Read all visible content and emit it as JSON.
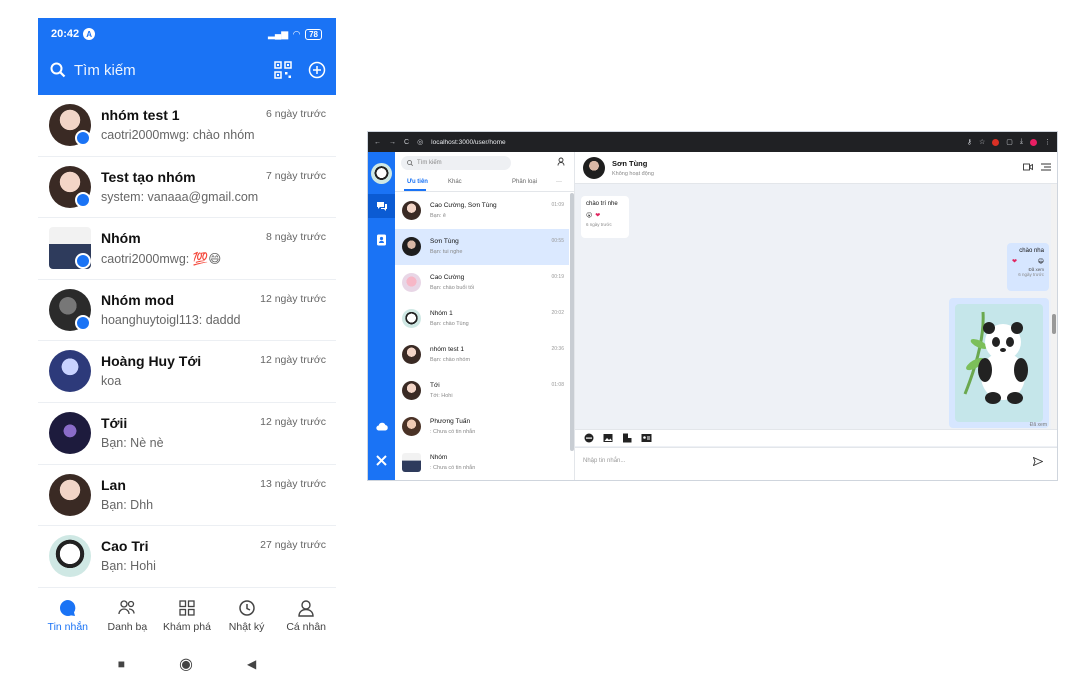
{
  "phone": {
    "status": {
      "time": "20:42",
      "badge": "A",
      "battery": "78"
    },
    "search_label": "Tìm kiếm",
    "conversations": [
      {
        "name": "nhóm test 1",
        "message": "caotri2000mwg: chào nhóm",
        "time": "6 ngày trước",
        "group": true
      },
      {
        "name": "Test tạo nhóm",
        "message": "system: vanaaa@gmail.com",
        "time": "7 ngày trước",
        "group": true
      },
      {
        "name": "Nhóm",
        "message": "caotri2000mwg: 💯😄",
        "time": "8 ngày trước",
        "group": true
      },
      {
        "name": "Nhóm mod",
        "message": "hoanghuytoigl113: daddd",
        "time": "12 ngày trước",
        "group": true
      },
      {
        "name": "Hoàng Huy Tới",
        "message": "koa",
        "time": "12 ngày trước",
        "group": false
      },
      {
        "name": "Tớii",
        "message": "Bạn: Nè nè",
        "time": "12 ngày trước",
        "group": false
      },
      {
        "name": "Lan",
        "message": "Bạn: Dhh",
        "time": "13 ngày trước",
        "group": false
      },
      {
        "name": "Cao Tri",
        "message": "Bạn: Hohi",
        "time": "27 ngày trước",
        "group": false
      }
    ],
    "nav": [
      {
        "label": "Tin nhắn",
        "icon": "chat-bubble-icon",
        "active": true
      },
      {
        "label": "Danh bạ",
        "icon": "contacts-icon",
        "active": false
      },
      {
        "label": "Khám phá",
        "icon": "grid-icon",
        "active": false
      },
      {
        "label": "Nhật ký",
        "icon": "clock-icon",
        "active": false
      },
      {
        "label": "Cá nhân",
        "icon": "person-icon",
        "active": false
      }
    ],
    "accent": "#1a73f5"
  },
  "browser": {
    "url": "localhost:3000/user/home",
    "search_placeholder": "Tìm kiếm",
    "tabs": {
      "priority": "Ưu tiên",
      "other": "Khác",
      "classify": "Phân loại",
      "more": "···"
    },
    "conversations": [
      {
        "name": "Cao Cường, Sơn Tùng",
        "message": "Bạn: ê",
        "time": "01:09",
        "selected": false
      },
      {
        "name": "Sơn Tùng",
        "message": "Bạn: tui nghe",
        "time": "00:55",
        "selected": true
      },
      {
        "name": "Cao Cường",
        "message": "Bạn: chào buổi tối",
        "time": "00:19",
        "selected": false
      },
      {
        "name": "Nhóm 1",
        "message": "Bạn: chào Tùng",
        "time": "20:02",
        "selected": false
      },
      {
        "name": "nhóm test 1",
        "message": "Bạn: chào nhóm",
        "time": "20:36",
        "selected": false
      },
      {
        "name": "Tới",
        "message": "Tới: Hohi",
        "time": "01:08",
        "selected": false
      },
      {
        "name": "Phương Tuấn",
        "message": ": Chưa có tin nhắn",
        "time": "",
        "selected": false
      },
      {
        "name": "Nhóm",
        "message": ": Chưa có tin nhắn",
        "time": "",
        "selected": false
      }
    ],
    "chat": {
      "name": "Sơn Tùng",
      "status": "Không hoạt động",
      "incoming": {
        "text": "chào trí nhe",
        "time": "6 ngày trước"
      },
      "outgoing": {
        "text": "chào nha",
        "seen": "Đã xem",
        "time": "6 ngày trước"
      },
      "image_seen": "Đã xem",
      "input_placeholder": "Nhập tin nhắn..."
    },
    "accent": "#1a73f5"
  }
}
